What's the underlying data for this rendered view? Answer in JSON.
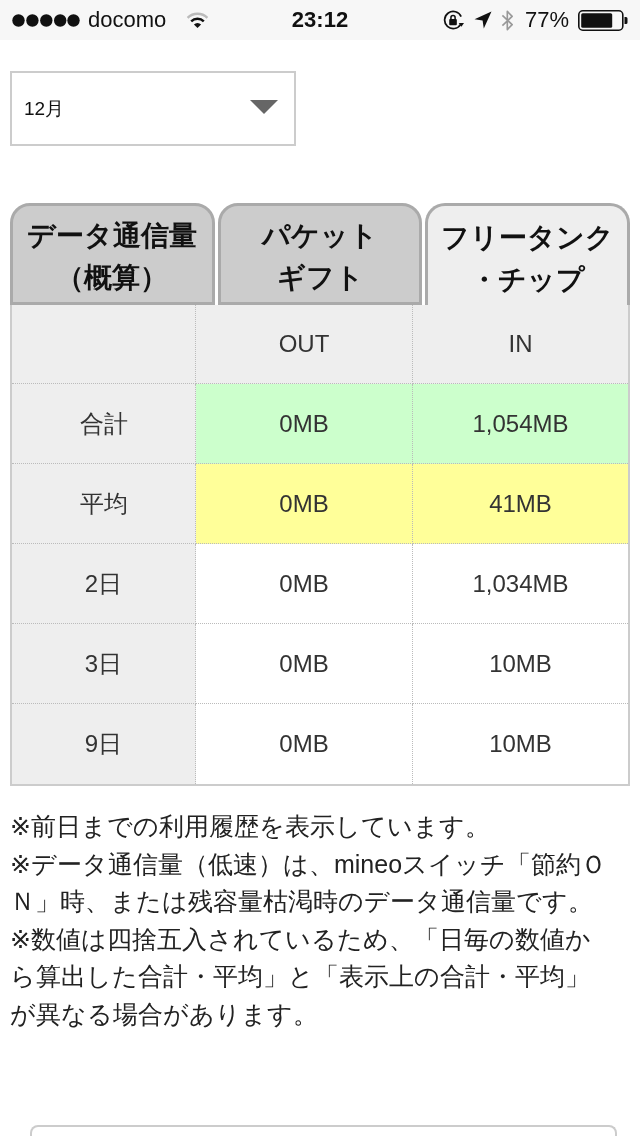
{
  "status_bar": {
    "carrier": "docomo",
    "time": "23:12",
    "battery": "77%"
  },
  "month_select": {
    "value": "12月"
  },
  "tabs": [
    {
      "label_lines": [
        "データ通信量",
        "（概算）"
      ],
      "selected": false
    },
    {
      "label_lines": [
        "パケット",
        "ギフト"
      ],
      "selected": false
    },
    {
      "label_lines": [
        "フリータンク",
        "・チップ"
      ],
      "selected": true
    }
  ],
  "table": {
    "columns": [
      "OUT",
      "IN"
    ],
    "rows": [
      {
        "label": "合計",
        "color": "#ccffcc",
        "cells": [
          "0MB",
          "1,054MB"
        ]
      },
      {
        "label": "平均",
        "color": "#ffff99",
        "cells": [
          "0MB",
          "41MB"
        ]
      },
      {
        "label": "2日",
        "color": "#ffffff",
        "cells": [
          "0MB",
          "1,034MB"
        ]
      },
      {
        "label": "3日",
        "color": "#ffffff",
        "cells": [
          "0MB",
          "10MB"
        ]
      },
      {
        "label": "9日",
        "color": "#ffffff",
        "cells": [
          "0MB",
          "10MB"
        ]
      }
    ]
  },
  "notes": [
    "※前日までの利用履歴を表示しています。",
    "※データ通信量（低速）は、mineoスイッチ「節約ＯＮ」時、または残容量枯渇時のデータ通信量です。",
    "※数値は四捨五入されているため、「日毎の数値から算出した合計・平均」と「表示上の合計・平均」が異なる場合があります。"
  ]
}
